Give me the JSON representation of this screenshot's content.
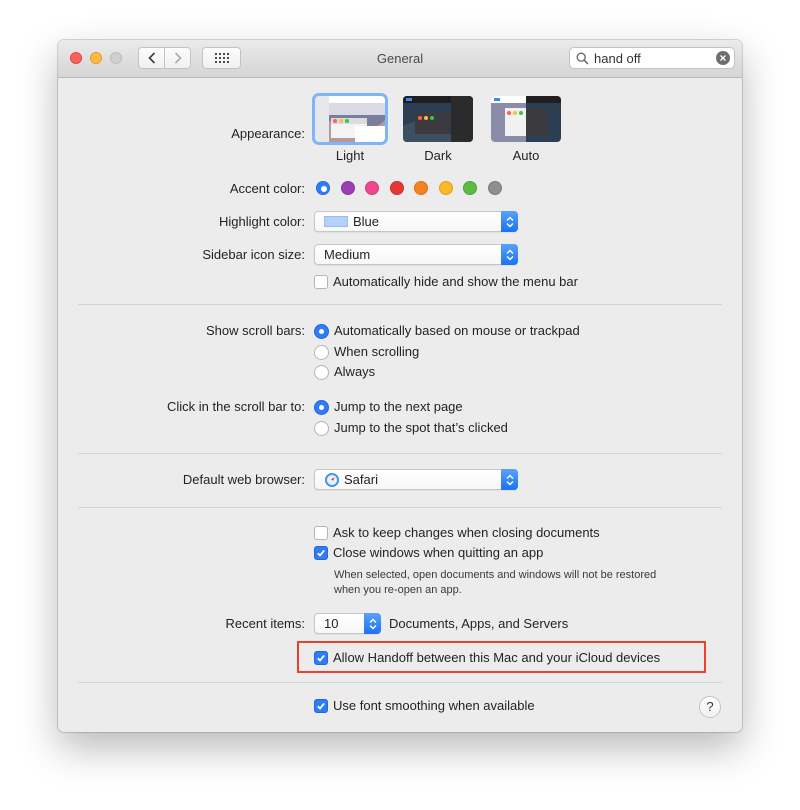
{
  "window": {
    "title": "General"
  },
  "search": {
    "value": "hand off"
  },
  "appearance": {
    "label": "Appearance:",
    "options": [
      {
        "name": "Light",
        "selected": true
      },
      {
        "name": "Dark",
        "selected": false
      },
      {
        "name": "Auto",
        "selected": false
      }
    ]
  },
  "accent": {
    "label": "Accent color:",
    "colors": [
      "#2f7cf6",
      "#9b3fb5",
      "#f0468f",
      "#e53835",
      "#f6821f",
      "#fdb827",
      "#5bbb42",
      "#8e8e8e"
    ],
    "selected_index": 0
  },
  "highlight": {
    "label": "Highlight color:",
    "value": "Blue",
    "swatch": "#b3d1f9"
  },
  "sidebar": {
    "label": "Sidebar icon size:",
    "value": "Medium"
  },
  "menubar": {
    "label": "Automatically hide and show the menu bar",
    "checked": false
  },
  "scrollbars": {
    "label": "Show scroll bars:",
    "options": [
      "Automatically based on mouse or trackpad",
      "When scrolling",
      "Always"
    ],
    "selected_index": 0
  },
  "click_scroll": {
    "label": "Click in the scroll bar to:",
    "options": [
      "Jump to the next page",
      "Jump to the spot that’s clicked"
    ],
    "selected_index": 0
  },
  "browser": {
    "label": "Default web browser:",
    "value": "Safari"
  },
  "ask_changes": {
    "label": "Ask to keep changes when closing documents",
    "checked": false
  },
  "close_windows": {
    "label": "Close windows when quitting an app",
    "checked": true
  },
  "close_note": {
    "line1": "When selected, open documents and windows will not be restored",
    "line2": "when you re-open an app."
  },
  "recent": {
    "label": "Recent items:",
    "value": "10",
    "suffix": "Documents, Apps, and Servers"
  },
  "handoff": {
    "label": "Allow Handoff between this Mac and your iCloud devices",
    "checked": true
  },
  "smoothing": {
    "label": "Use font smoothing when available",
    "checked": true
  },
  "help": {
    "label": "?"
  }
}
